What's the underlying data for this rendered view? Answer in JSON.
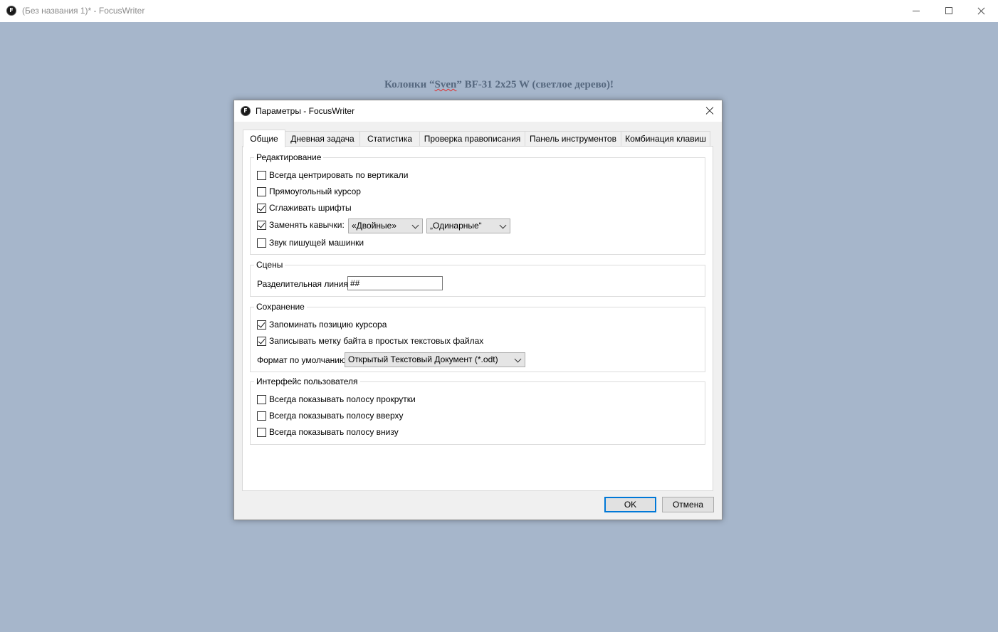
{
  "window": {
    "title": "(Без названия 1)* - FocusWriter",
    "icon": "focuswriter-icon"
  },
  "document": {
    "heading_before": "Колонки “",
    "heading_misspelled": "Sven",
    "heading_after": "” BF-31 2x25 W (светлое дерево)!"
  },
  "dialog": {
    "title": "Параметры - FocusWriter",
    "tabs": [
      {
        "label": "Общие",
        "active": true
      },
      {
        "label": "Дневная задача"
      },
      {
        "label": "Статистика"
      },
      {
        "label": "Проверка правописания"
      },
      {
        "label": "Панель инструментов"
      },
      {
        "label": "Комбинация клавиш"
      }
    ],
    "editing": {
      "title": "Редактирование",
      "always_center": {
        "label": "Всегда центрировать по вертикали",
        "checked": false
      },
      "block_cursor": {
        "label": "Прямоугольный курсор",
        "checked": false
      },
      "smooth_fonts": {
        "label": "Сглаживать шрифты",
        "checked": true
      },
      "smart_quotes": {
        "label": "Заменять кавычки:",
        "checked": true
      },
      "double_quotes": "«Двойные»",
      "single_quotes": "„Одинарные“",
      "typewriter_sound": {
        "label": "Звук пишущей машинки",
        "checked": false
      }
    },
    "scenes": {
      "title": "Сцены",
      "divider_label": "Разделительная линия:",
      "divider_value": "##"
    },
    "saving": {
      "title": "Сохранение",
      "remember_cursor": {
        "label": "Запоминать позицию курсора",
        "checked": true
      },
      "write_bom": {
        "label": "Записывать метку байта в простых текстовых файлах",
        "checked": true
      },
      "default_format_label": "Формат по умолчанию:",
      "default_format_value": "Открытый Текстовый Документ (*.odt)"
    },
    "ui": {
      "title": "Интерфейс пользователя",
      "always_scrollbar": {
        "label": "Всегда показывать полосу прокрутки",
        "checked": false
      },
      "always_top": {
        "label": "Всегда показывать полосу вверху",
        "checked": false
      },
      "always_bottom": {
        "label": "Всегда показывать полосу внизу",
        "checked": false
      }
    },
    "buttons": {
      "ok": "OK",
      "cancel": "Отмена"
    }
  },
  "colors": {
    "desktop": "#a6b6cb",
    "heading": "#56687f",
    "focus_blue": "#0078d7"
  }
}
